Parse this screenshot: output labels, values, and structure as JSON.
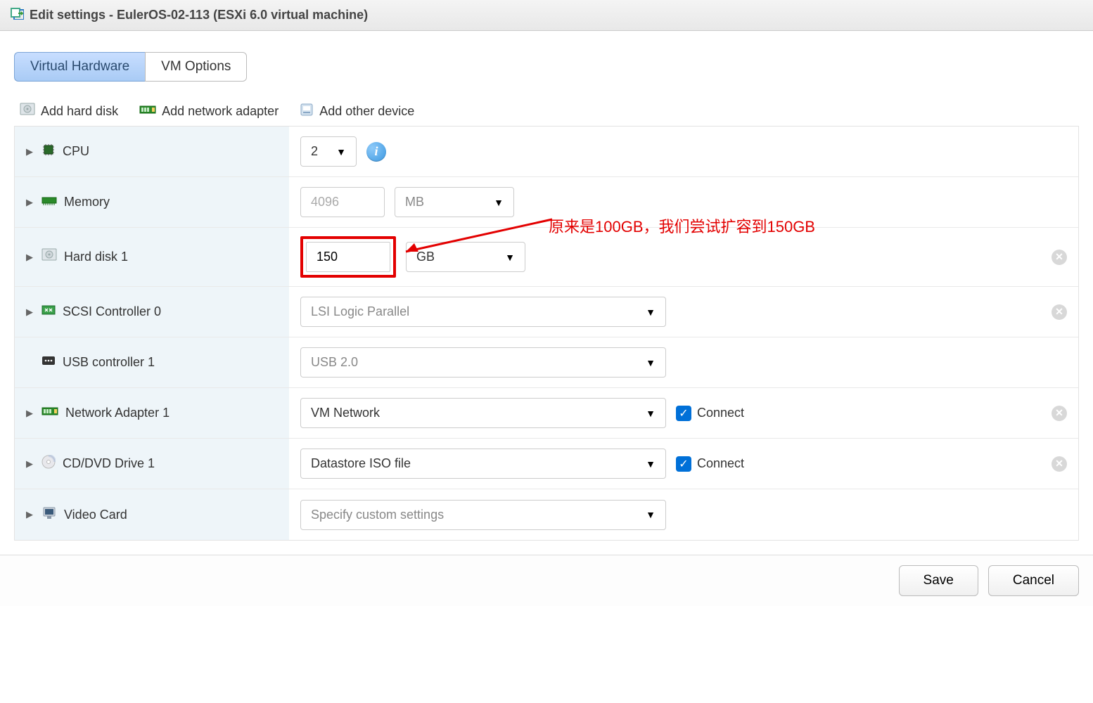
{
  "titlebar": {
    "title": "Edit settings - EulerOS-02-113 (ESXi 6.0 virtual machine)"
  },
  "tabs": {
    "virtual_hw": "Virtual Hardware",
    "vm_options": "VM Options"
  },
  "toolbar": {
    "add_hd": "Add hard disk",
    "add_net": "Add network adapter",
    "add_other": "Add other device"
  },
  "rows": {
    "cpu": {
      "label": "CPU",
      "value": "2"
    },
    "memory": {
      "label": "Memory",
      "value": "4096",
      "unit": "MB"
    },
    "hd": {
      "label": "Hard disk 1",
      "value": "150",
      "unit": "GB"
    },
    "scsi": {
      "label": "SCSI Controller 0",
      "value": "LSI Logic Parallel"
    },
    "usb": {
      "label": "USB controller 1",
      "value": "USB 2.0"
    },
    "net": {
      "label": "Network Adapter 1",
      "value": "VM Network",
      "connect": "Connect"
    },
    "cd": {
      "label": "CD/DVD Drive 1",
      "value": "Datastore ISO file",
      "connect": "Connect"
    },
    "video": {
      "label": "Video Card",
      "value": "Specify custom settings"
    }
  },
  "annotation": "原来是100GB，我们尝试扩容到150GB",
  "footer": {
    "save": "Save",
    "cancel": "Cancel"
  }
}
